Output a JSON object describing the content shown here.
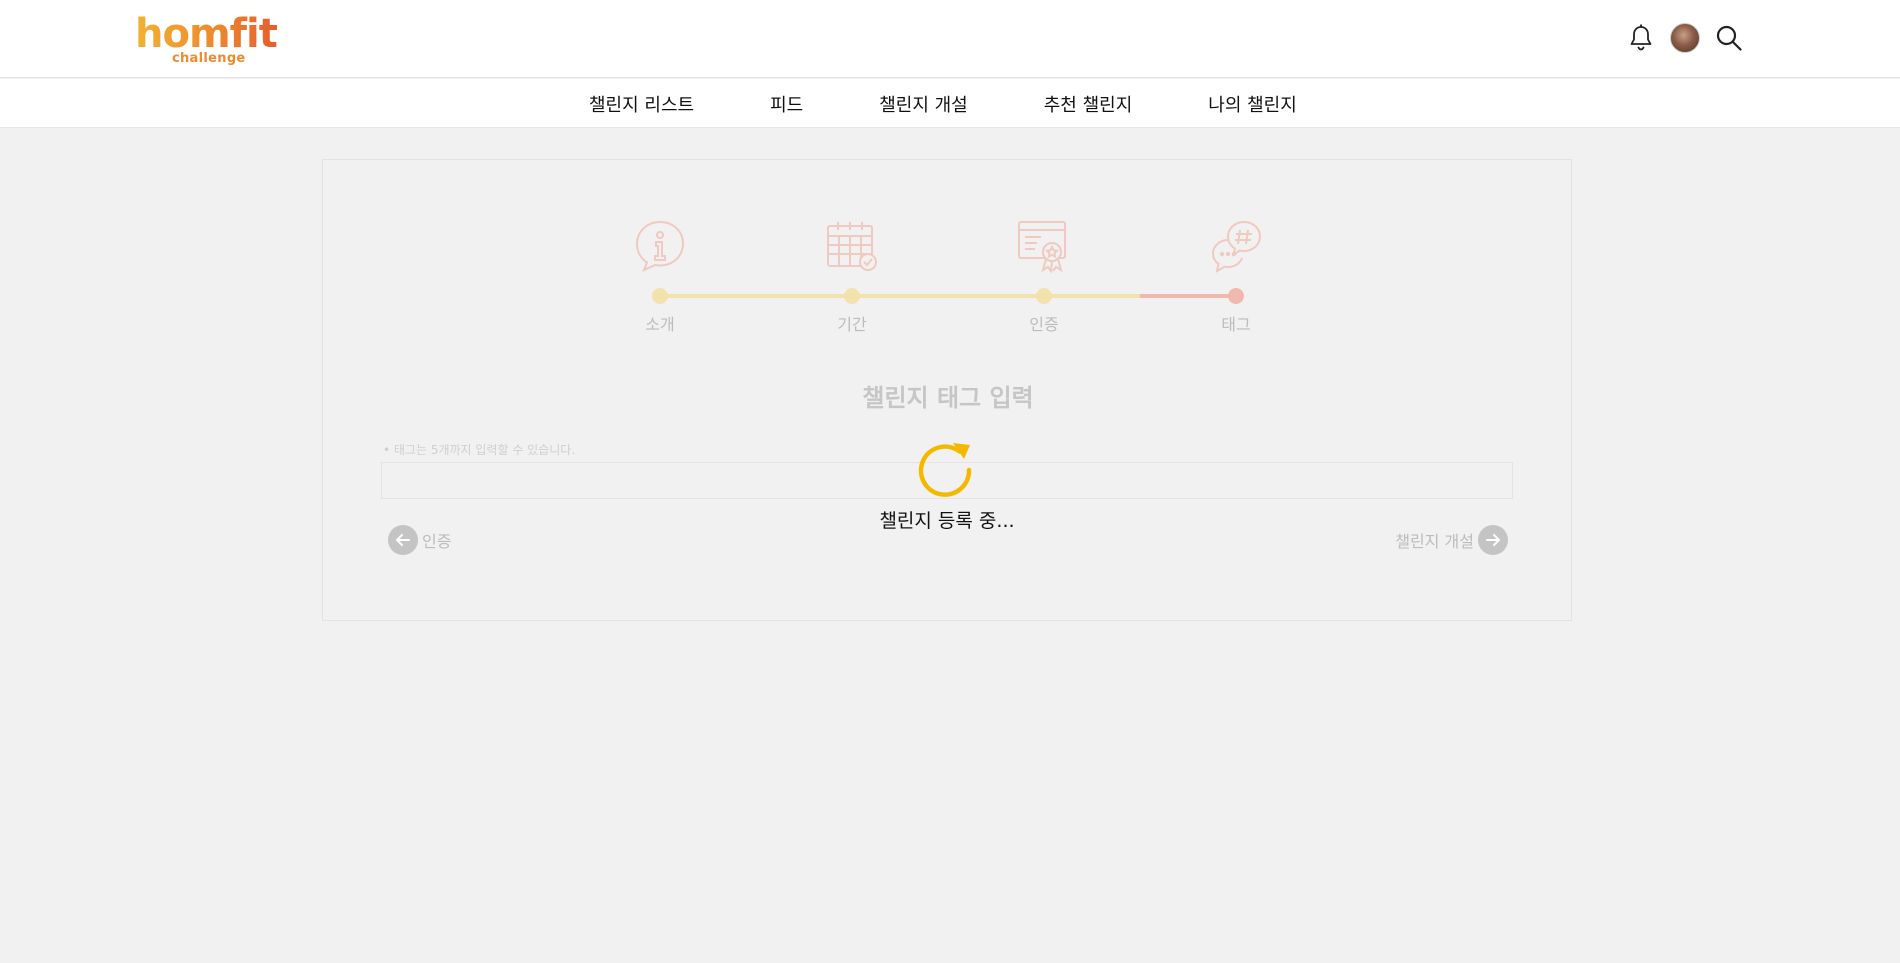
{
  "header": {
    "logo": {
      "main": "homfit",
      "sub": "challenge"
    },
    "icons": [
      "bell-icon",
      "avatar",
      "search-icon"
    ]
  },
  "nav": {
    "items": [
      "챌린지 리스트",
      "피드",
      "챌린지 개설",
      "추천 챌린지",
      "나의 챌린지"
    ]
  },
  "stepper": {
    "steps": [
      {
        "label": "소개",
        "icon": "info-icon"
      },
      {
        "label": "기간",
        "icon": "calendar-icon"
      },
      {
        "label": "인증",
        "icon": "certificate-icon"
      },
      {
        "label": "태그",
        "icon": "chat-hashtag-icon"
      }
    ],
    "current_step": 4,
    "colors": {
      "done": "#f2e2ae",
      "current": "#f1b9ad",
      "icon": "#f0c9c0"
    }
  },
  "form": {
    "title": "챌린지 태그 입력",
    "hint": "• 태그는 5개까지 입력할 수 있습니다.",
    "tag_input": {
      "value": "",
      "placeholder": ""
    }
  },
  "buttons": {
    "prev_label": "인증",
    "next_label": "챌린지 개설"
  },
  "loading": {
    "text": "챌린지 등록 중...",
    "color": "#f5b800"
  }
}
